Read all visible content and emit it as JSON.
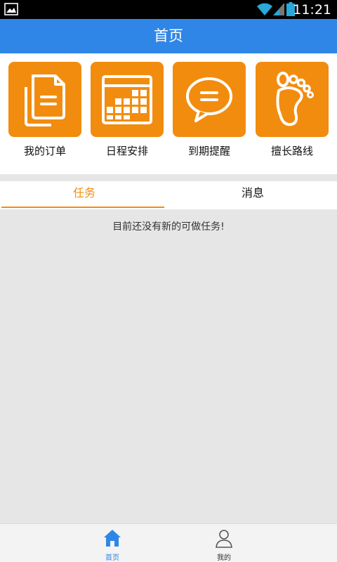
{
  "status_bar": {
    "time": "11:21",
    "icons": [
      "gallery-icon",
      "wifi-icon",
      "signal-icon",
      "battery-icon"
    ]
  },
  "header": {
    "title": "首页"
  },
  "shortcuts": [
    {
      "label": "我的订单",
      "icon": "documents-icon"
    },
    {
      "label": "日程安排",
      "icon": "calendar-icon"
    },
    {
      "label": "到期提醒",
      "icon": "chat-bubble-icon"
    },
    {
      "label": "擅长路线",
      "icon": "footprint-icon"
    }
  ],
  "tabs": [
    {
      "label": "任务",
      "active": true
    },
    {
      "label": "消息",
      "active": false
    }
  ],
  "content": {
    "empty_message": "目前还没有新的可做任务!"
  },
  "bottom_nav": [
    {
      "label": "首页",
      "icon": "home-icon",
      "active": true
    },
    {
      "label": "我的",
      "icon": "person-icon",
      "active": false
    }
  ],
  "colors": {
    "primary_blue": "#2f86e6",
    "accent_orange": "#f28c0f",
    "background_gray": "#e6e6e6"
  }
}
